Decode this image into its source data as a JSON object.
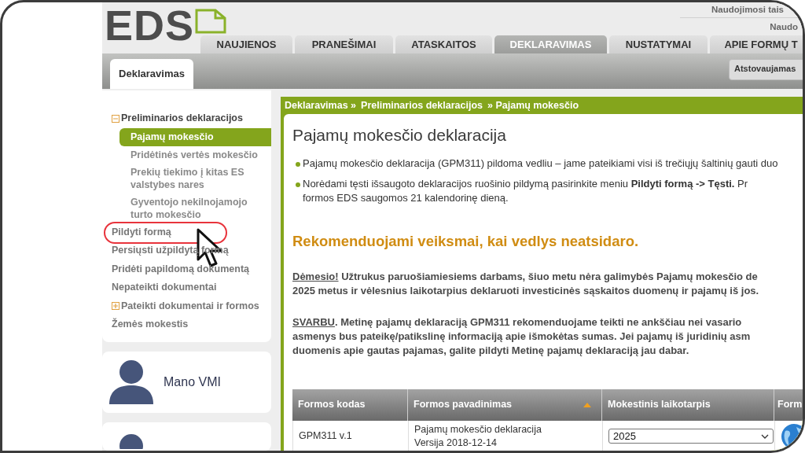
{
  "logo": {
    "text": "EDS"
  },
  "top_links": [
    "Naudojimosi tais",
    "Naudo"
  ],
  "tabs": [
    {
      "label": "NAUJIENOS",
      "selected": false
    },
    {
      "label": "PRANEŠIMAI",
      "selected": false
    },
    {
      "label": "ATASKAITOS",
      "selected": false
    },
    {
      "label": "DEKLARAVIMAS",
      "selected": true
    },
    {
      "label": "NUSTATYMAI",
      "selected": false
    },
    {
      "label": "APIE FORMŲ T",
      "selected": false
    }
  ],
  "subtab": {
    "label": "Deklaravimas",
    "selected": true
  },
  "represented_button": "Atstovaujamas",
  "sidebar": {
    "items": [
      {
        "kind": "group",
        "label": "Preliminarios deklaracijos",
        "expanded": true,
        "circled": false,
        "children": [
          {
            "label": "Pajamų mokesčio",
            "selected": true
          },
          {
            "label": "Pridėtinės vertės mokesčio",
            "selected": false
          },
          {
            "label": "Prekių tiekimo į kitas ES valstybes nares",
            "selected": false
          },
          {
            "label": "Gyventojo nekilnojamojo turto mokesčio",
            "selected": false
          }
        ]
      },
      {
        "kind": "link",
        "label": "Pildyti formą",
        "circled": true
      },
      {
        "kind": "link",
        "label": "Persiųsti užpildytą formą",
        "circled": false
      },
      {
        "kind": "link",
        "label": "Pridėti papildomą dokumentą",
        "circled": false
      },
      {
        "kind": "link",
        "label": "Nepateikti dokumentai",
        "circled": false
      },
      {
        "kind": "group",
        "label": "Pateikti dokumentai ir formos",
        "expanded": false,
        "circled": false
      },
      {
        "kind": "link",
        "label": "Žemės mokestis",
        "circled": false
      }
    ]
  },
  "profile_card": {
    "label": "Mano VMI"
  },
  "breadcrumb": [
    "Deklaravimas »",
    "Preliminarios deklaracijos",
    "» Pajamų mokesčio"
  ],
  "page_title": "Pajamų mokesčio deklaracija",
  "bullets": [
    {
      "lines": [
        "Pajamų mokesčio deklaracija (GPM311) pildoma vedliu – jame pateikiami visi iš trečiųjų šaltinių gauti duo"
      ]
    },
    {
      "lines": [
        "Norėdami tęsti išsaugoto deklaracijos ruošinio pildymą pasirinkite meniu **Pildyti formą -> Tęsti.** Pr",
        "formos EDS saugomos 21 kalendorinę dieną."
      ]
    }
  ],
  "notice_heading": "Rekomenduojami veiksmai, kai vedlys neatsidaro.",
  "notices": [
    {
      "lead": "Dėmesio!",
      "lines": [
        " Užtrukus paruošiamiesiems darbams, šiuo metu nėra galimybės Pajamų mokesčio de",
        "2025 metus ir vėlesnius laikotarpius deklaruoti investicinės sąskaitos duomenų ir pajamų iš jos."
      ]
    },
    {
      "lead": "SVARBU",
      "lines": [
        ". Metinę pajamų deklaraciją GPM311 rekomenduojame teikti ne ankščiau nei vasario",
        "asmenys bus pateikę/patikslinę informaciją apie išmokėtas sumas. Jei pajamų iš juridinių asm",
        "duomenis apie gautas pajamas, galite pildyti Metinę pajamų deklaraciją jau dabar."
      ]
    }
  ],
  "table": {
    "columns": [
      {
        "label": "Formos kodas",
        "sorted": false
      },
      {
        "label": "Formos pavadinimas",
        "sorted": true
      },
      {
        "label": "Mokestinis laikotarpis",
        "sorted": false
      },
      {
        "label": "Form",
        "sorted": false
      }
    ],
    "rows": [
      {
        "code": "GPM311 v.1",
        "name": "Pajamų mokesčio deklaracija",
        "version": "Versija 2018-12-14",
        "period": "2025"
      }
    ]
  }
}
